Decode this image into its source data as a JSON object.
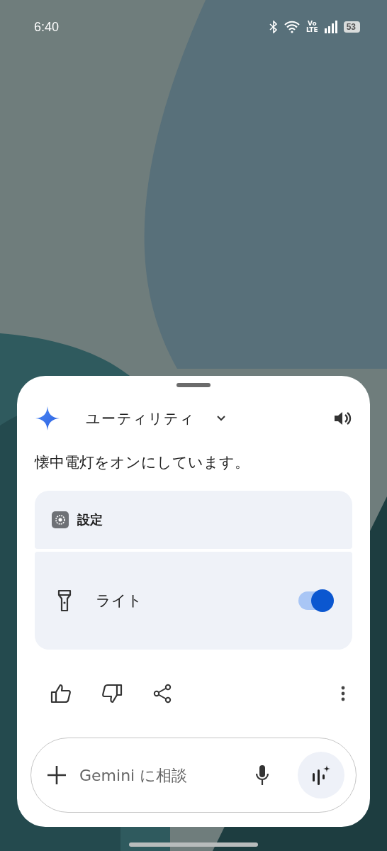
{
  "status_bar": {
    "time": "6:40",
    "network": "Vo\nLTE",
    "battery": "53"
  },
  "sheet": {
    "title": "ユーティリティ",
    "message": "懐中電灯をオンにしています。",
    "card": {
      "header": "設定",
      "toggle": {
        "label": "ライト",
        "on": true
      }
    },
    "input": {
      "placeholder": "Gemini に相談"
    }
  }
}
